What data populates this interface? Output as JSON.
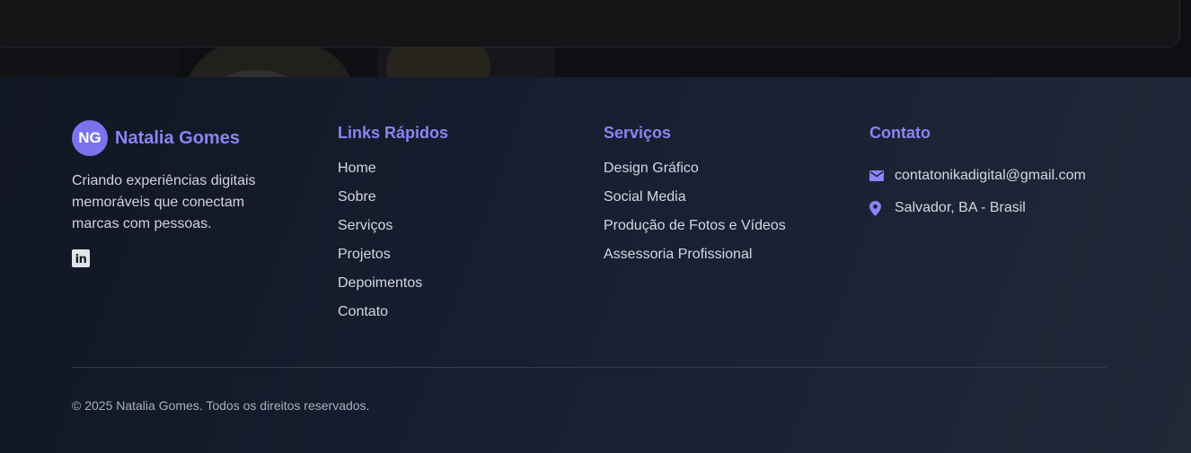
{
  "brand": {
    "initials": "NG",
    "name": "Natalia Gomes",
    "description": "Criando experiências digitais memoráveis que conectam marcas com pessoas.",
    "social_icon": "linkedin-icon"
  },
  "quick_links": {
    "title": "Links Rápidos",
    "items": [
      "Home",
      "Sobre",
      "Serviços",
      "Projetos",
      "Depoimentos",
      "Contato"
    ]
  },
  "services": {
    "title": "Serviços",
    "items": [
      "Design Gráfico",
      "Social Media",
      "Produção de Fotos e Vídeos",
      "Assessoria Profissional"
    ]
  },
  "contact": {
    "title": "Contato",
    "email": "contatonikadigital@gmail.com",
    "email_icon": "mail-icon",
    "location": "Salvador, BA - Brasil",
    "location_icon": "map-pin-icon"
  },
  "copyright": "© 2025 Natalia Gomes. Todos os direitos reservados.",
  "colors": {
    "accent": "#8b84f6",
    "avatar_bg": "#7b73ee",
    "footer_bg_start": "#111623",
    "footer_bg_end": "#212838",
    "text": "#d4d8e0",
    "muted_text": "#a9afbb"
  }
}
